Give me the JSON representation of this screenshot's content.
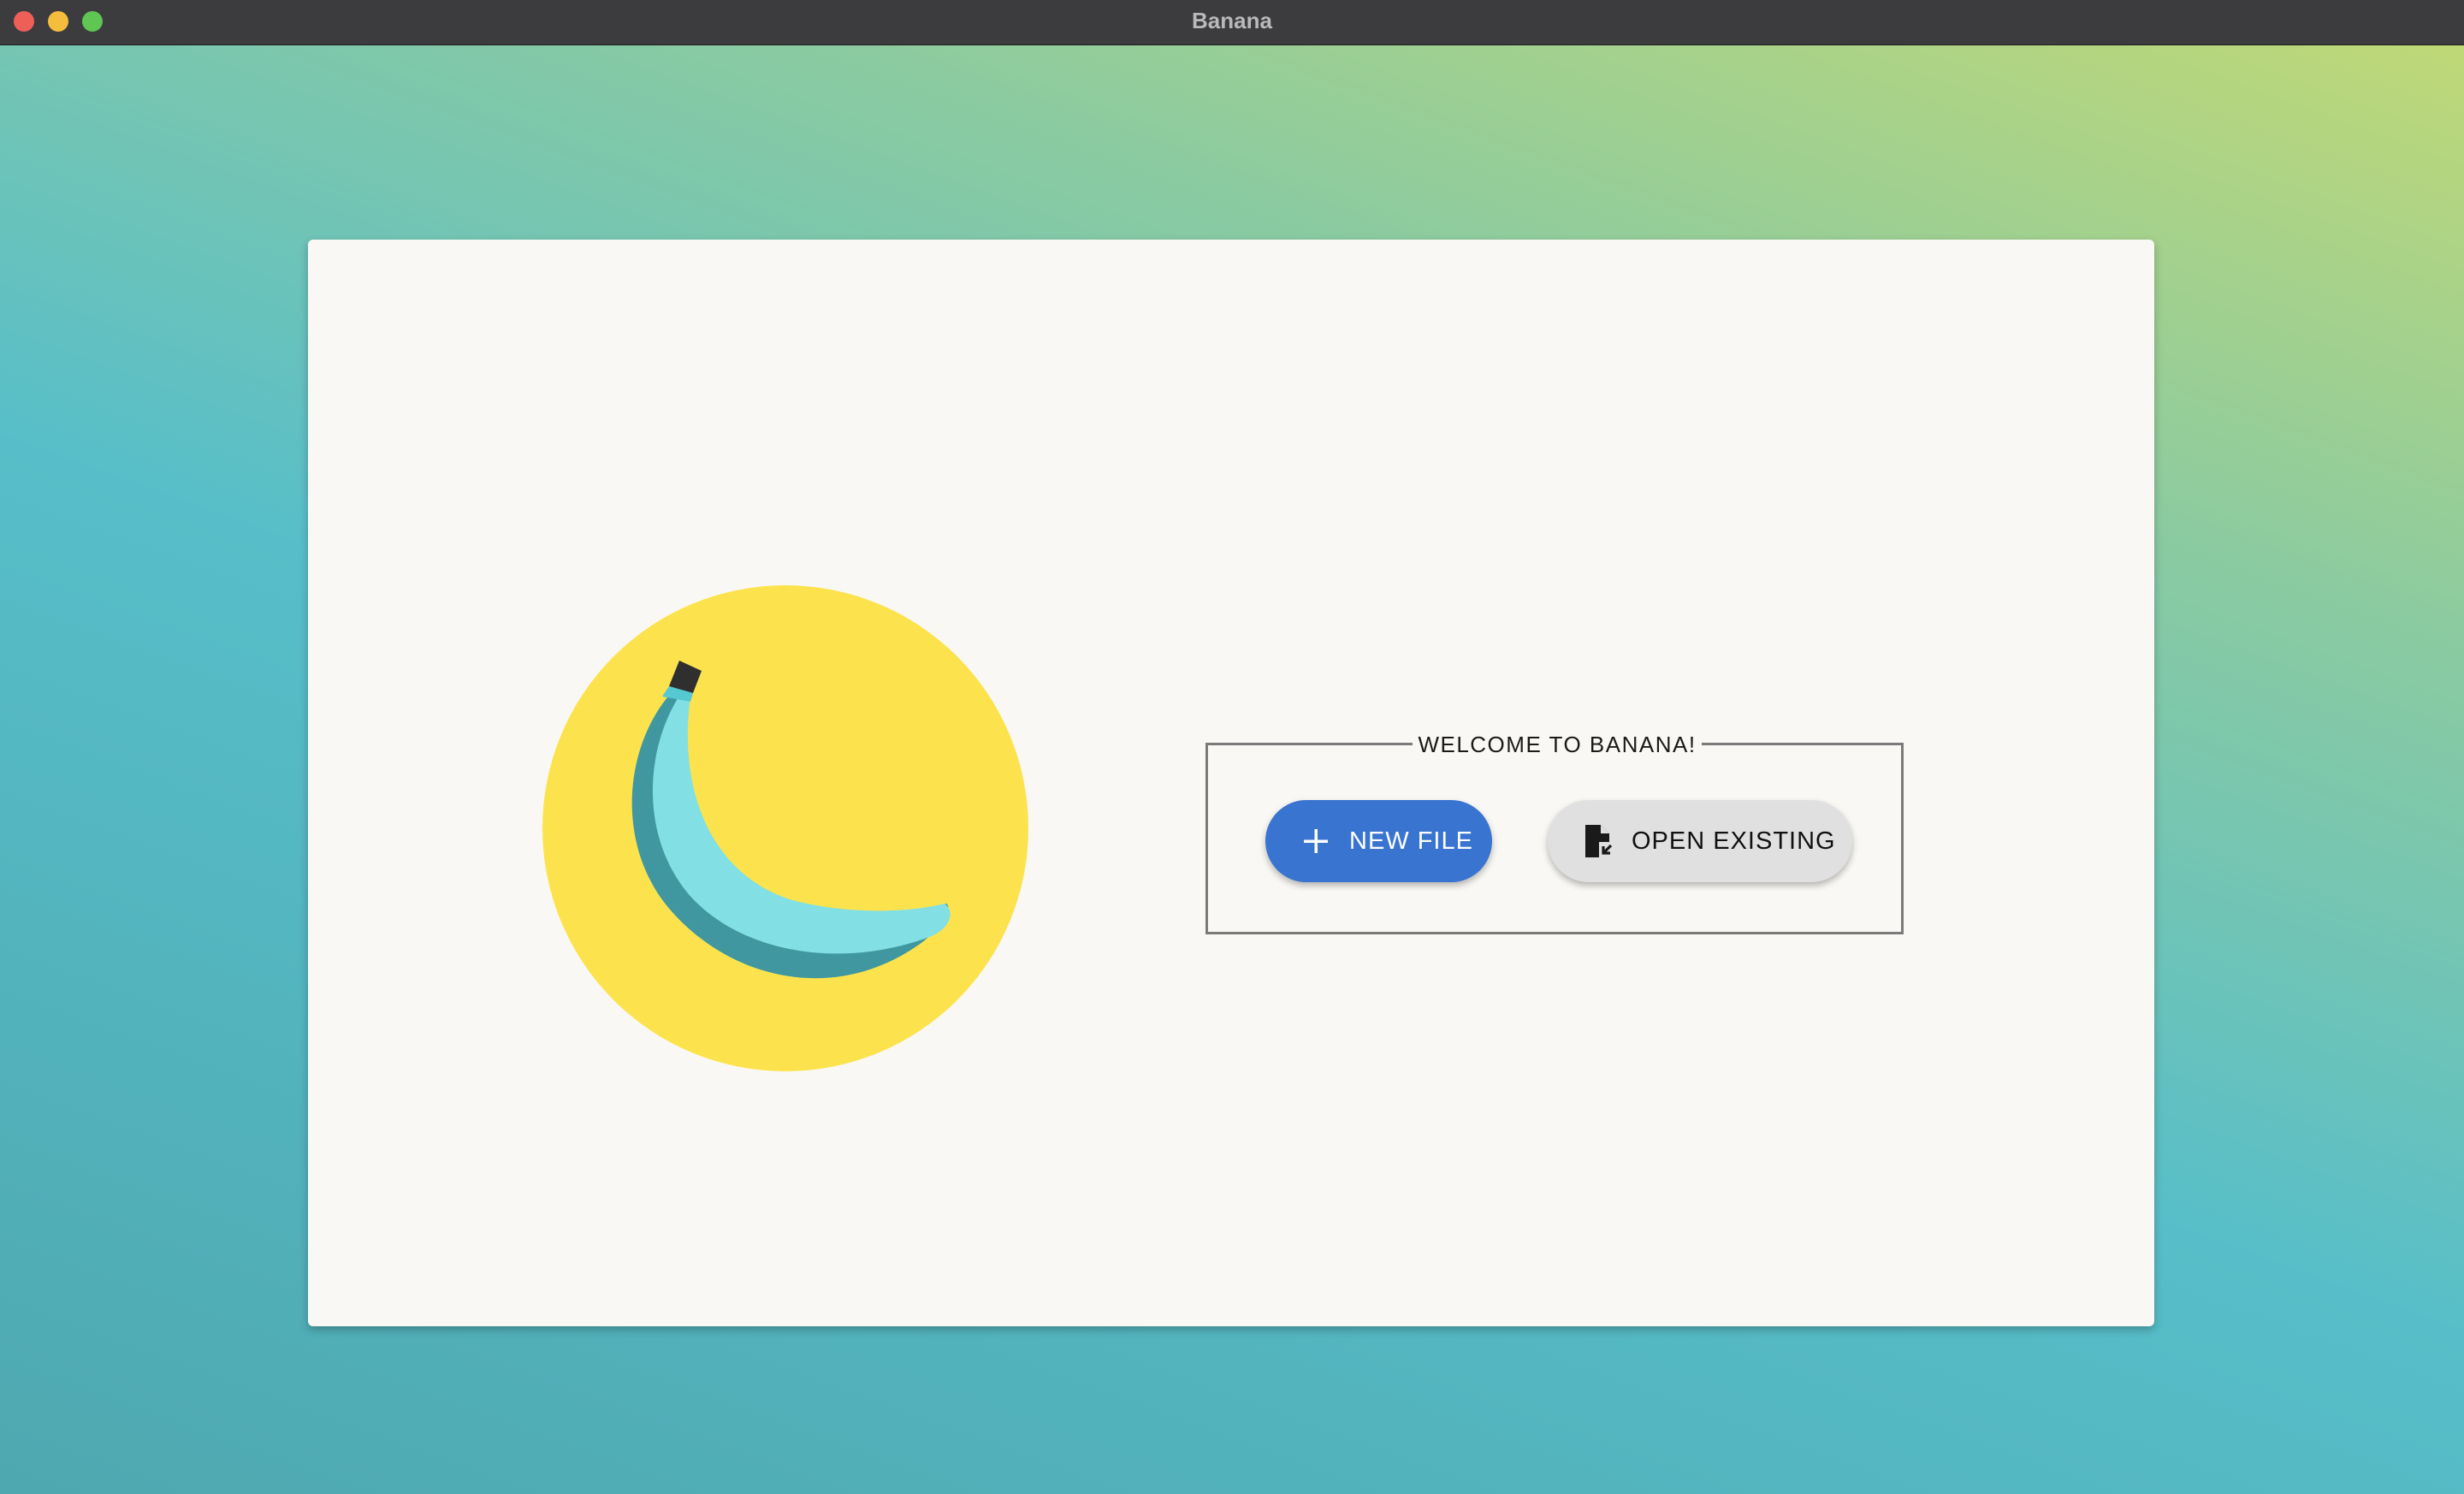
{
  "window": {
    "title": "Banana"
  },
  "welcome": {
    "legend": "WELCOME TO BANANA!",
    "new_file_label": "NEW FILE",
    "open_existing_label": "OPEN EXISTING"
  },
  "icons": {
    "new_file": "plus-icon",
    "open_existing": "file-open-icon",
    "logo": "banana-logo"
  },
  "colors": {
    "primary": "#3874d0",
    "secondary": "#e0e0e0",
    "logo_circle": "#fce34d",
    "banana_light": "#82dfe3",
    "banana_dark": "#4197a0"
  }
}
